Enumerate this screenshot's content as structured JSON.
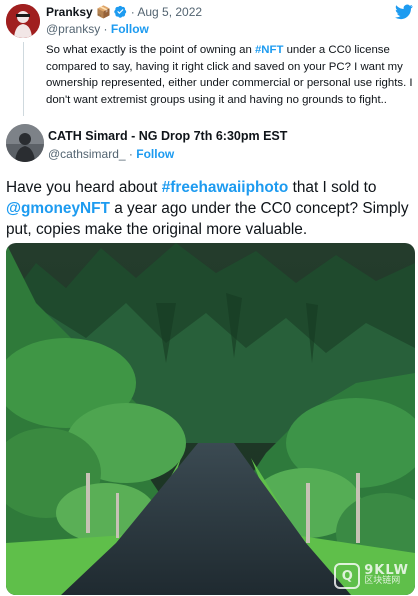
{
  "quoted_tweet": {
    "name": "Pranksy",
    "name_emoji": "📦",
    "verified": true,
    "separator": "·",
    "date": "Aug 5, 2022",
    "handle": "@pranksy",
    "follow_label": "Follow",
    "body_parts": [
      "So what exactly is the point of owning an ",
      "#NFT",
      " under a CC0 license compared to say, having it right click and saved on your PC? I want my ownership represented, either under commercial or personal use rights. I don't want extremist groups using it and having no grounds to fight.."
    ]
  },
  "main_tweet": {
    "name": "CATH Simard - NG Drop 7th 6:30pm EST",
    "handle": "@cathsimard_",
    "separator": "·",
    "follow_label": "Follow",
    "text_parts": [
      "Have you heard about ",
      "#freehawaiiphoto",
      " that I sold to ",
      "@gmoneyNFT",
      " a year ago under the CC0 concept? Simply put, copies make the original more valuable."
    ]
  },
  "watermark": {
    "logo_text": "Q",
    "brand": "9KLW",
    "subtitle": "区块链网"
  },
  "colors": {
    "accent": "#1d9bf0",
    "text": "#0f1419",
    "muted": "#536471"
  },
  "icons": [
    "twitter-bird-icon",
    "verified-badge-icon"
  ]
}
